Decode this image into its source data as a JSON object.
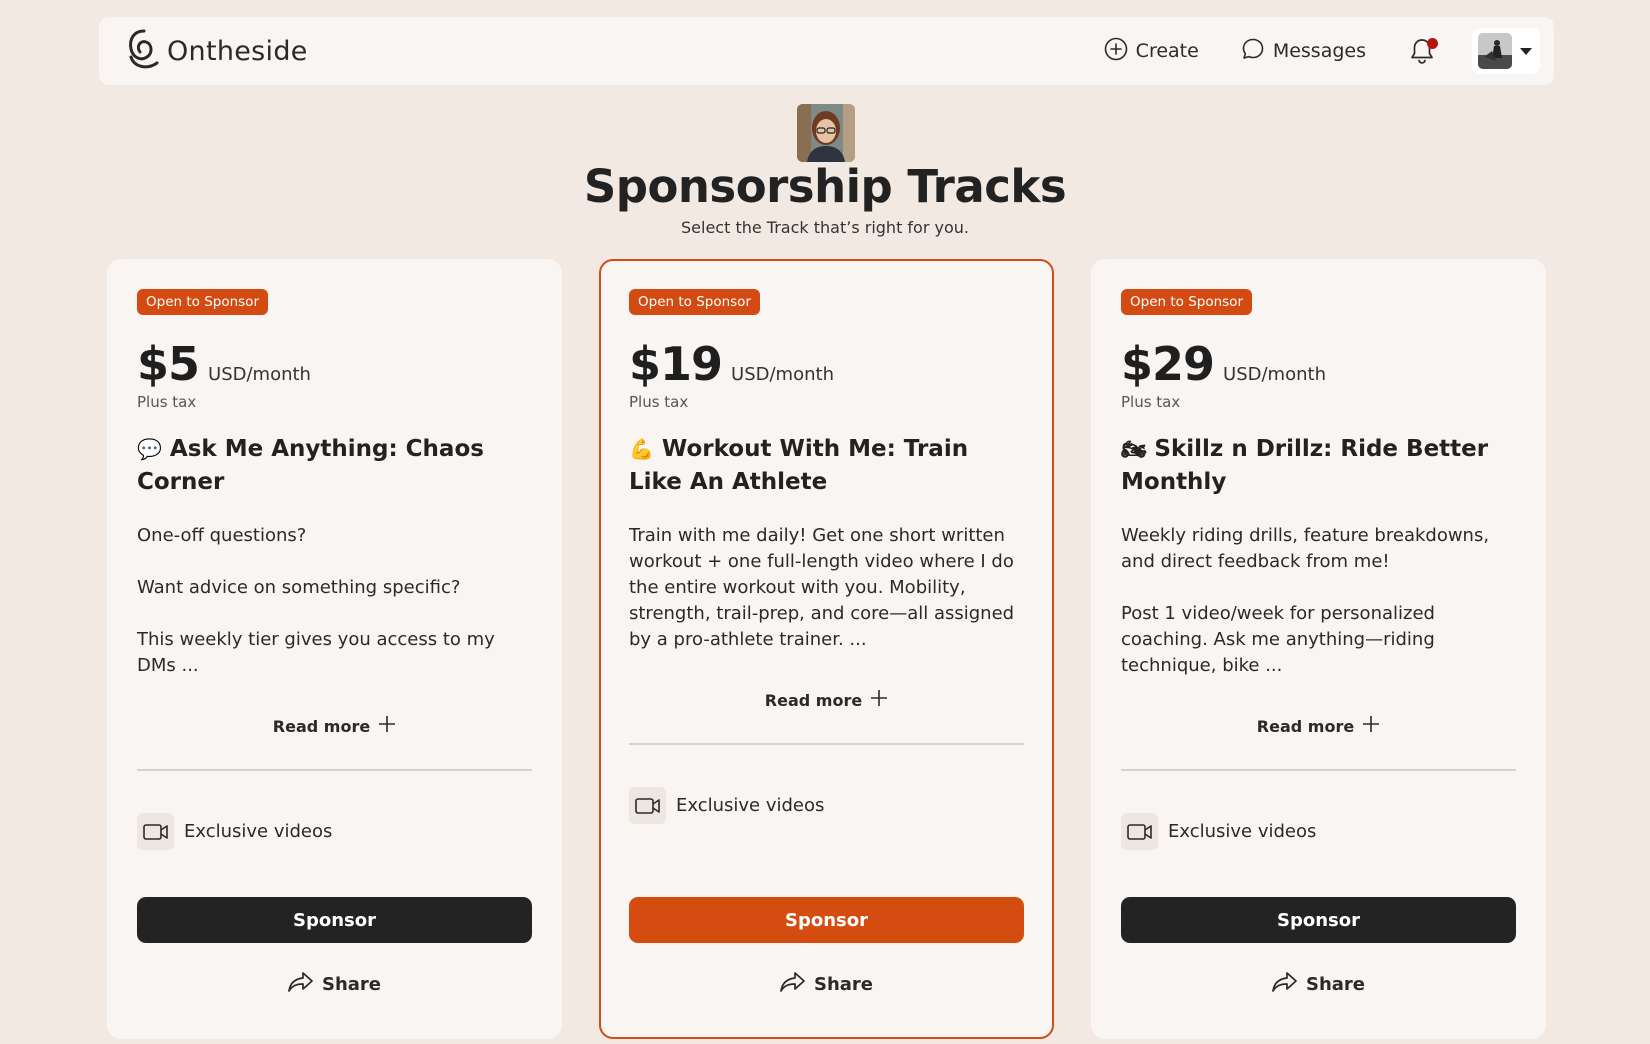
{
  "brand": {
    "name": "Ontheside"
  },
  "nav": {
    "create_label": "Create",
    "messages_label": "Messages"
  },
  "header": {
    "title": "Sponsorship Tracks",
    "subtitle": "Select the Track that’s right for you."
  },
  "tracks": [
    {
      "badge": "Open to Sponsor",
      "price": "$5",
      "period": "USD/month",
      "tax_note": "Plus tax",
      "emoji": "💬",
      "title": "Ask Me Anything: Chaos Corner",
      "description": [
        "One-off questions?",
        "Want advice on something specific?",
        "This weekly tier gives you access to my DMs ..."
      ],
      "read_more": "Read more",
      "feature": "Exclusive videos",
      "sponsor_label": "Sponsor",
      "share_label": "Share"
    },
    {
      "badge": "Open to Sponsor",
      "price": "$19",
      "period": "USD/month",
      "tax_note": "Plus tax",
      "emoji": "💪",
      "title": "Workout With Me: Train Like An Athlete",
      "description": [
        "Train with me daily! Get one short written workout + one full-length video where I do the entire workout with you. Mobility, strength, trail-prep, and core—all assigned by a pro-athlete trainer. ..."
      ],
      "read_more": "Read more",
      "feature": "Exclusive videos",
      "sponsor_label": "Sponsor",
      "share_label": "Share"
    },
    {
      "badge": "Open to Sponsor",
      "price": "$29",
      "period": "USD/month",
      "tax_note": "Plus tax",
      "emoji": "🏍",
      "title": "Skillz n Drillz: Ride Better Monthly",
      "description": [
        "Weekly riding drills, feature breakdowns, and direct feedback from me!",
        "Post 1 video/week for personalized coaching. Ask me anything—riding technique, bike ..."
      ],
      "read_more": "Read more",
      "feature": "Exclusive videos",
      "sponsor_label": "Sponsor",
      "share_label": "Share"
    }
  ],
  "colors": {
    "background": "#f1e9e2",
    "accent": "#d44c10",
    "dark_button": "#232323",
    "notification_dot": "#b3150f"
  },
  "icons": [
    "logo-icon",
    "plus-circle-icon",
    "chat-bubble-icon",
    "bell-icon",
    "chevron-down-icon",
    "video-camera-icon",
    "share-arrow-icon",
    "plus-icon"
  ]
}
